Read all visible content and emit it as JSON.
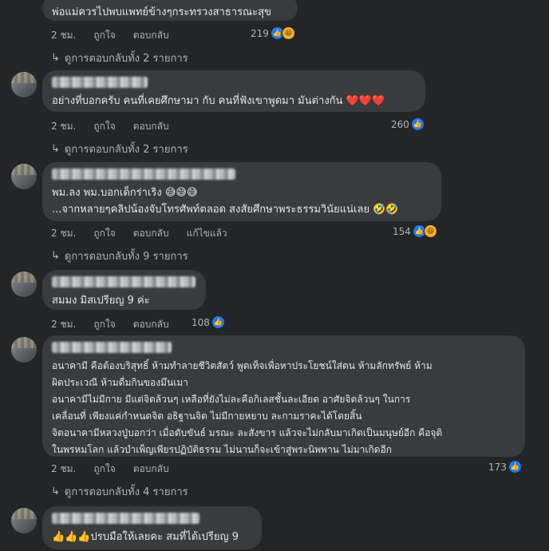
{
  "meta_labels": {
    "like": "ถูกใจ",
    "reply": "ตอบกลับ",
    "edited": "แก้ไขแล้ว"
  },
  "comments": [
    {
      "lines": [
        "พ่อแม่ควรไปพบแพทย์ข้างๆกระทรวงสาธารณะสุข"
      ],
      "time": "2 ชม.",
      "reaction_count": "219",
      "reactions": [
        "like-icon",
        "haha-icon"
      ],
      "replies": "ดูการตอบกลับทั้ง 2 รายการ"
    },
    {
      "lines": [
        "อย่างที่บอกครับ คนที่เคยศึกษามา กับ คนที่ฟังเขาพูดมา มันต่างกัน ❤️❤️❤️"
      ],
      "time": "2 ชม.",
      "reaction_count": "260",
      "reactions": [
        "like-icon"
      ],
      "replies": "ดูการตอบกลับทั้ง 2 รายการ"
    },
    {
      "lines": [
        "พม.ลง พม.บอกเด็กร่าเริง 😅😅😅",
        "...จากหลายๆคลิปน้องจับโทรศัพท์ตลอด สงสัยศึกษาพระธรรมวินัยแน่เลย 🤣🤣"
      ],
      "time": "2 ชม.",
      "reaction_count": "154",
      "reactions": [
        "like-icon",
        "haha-icon"
      ],
      "replies": "ดูการตอบกลับทั้ง 9 รายการ"
    },
    {
      "lines": [
        "สมมง มิสเปรียญ 9 ค่ะ"
      ],
      "time": "2 ชม.",
      "reaction_count": "108",
      "reactions": [
        "like-icon"
      ]
    },
    {
      "lines": [
        "อนาคามี คือต้องบริสุทธิ์ ห้ามทำลายชีวิตสัตว์ พูดเท็จเพื่อหาประโยชน์ใส่ตน ห้ามลักทรัพย์ ห้าม",
        "ผิดประเวณี ห้ามดื่มกินของมึนเมา",
        "อนาคามีไม่มีกาย มีแต่จิตล้วนๆ เหลือที่ยังไม่ละคือกิเลสชั้นละเอียด อาศัยจิตล้วนๆ ในการ",
        "เคลื่อนที่ เพียงแค่กำหนดจิต อธิฐานจิต ไม่มีกายหยาบ ละกามราคะได้โดยสิ้น",
        "จิตอนาคามีหลวงปู่บอกว่า เมื่อดับขันธ์ มรณะ ละสังขาร แล้วจะไม่กลับมาเกิดเป็นมนุษย์อีก คือจุติ",
        "ในพรหมโลก แล้วบำเพ็ญเพียรปฏิบัติธรรม ไม่นานก็จะเข้าสู่พระนิพพาน ไม่มาเกิดอีก"
      ],
      "time": "2 ชม.",
      "reaction_count": "173",
      "reactions": [
        "like-icon"
      ],
      "replies": "ดูการตอบกลับทั้ง 4 รายการ"
    },
    {
      "lines": [
        "👍👍👍ปรบมือให้เลยคะ สมที่ได้เปรียญ 9"
      ]
    }
  ],
  "colors": {
    "background": "#242526",
    "bubble": "#3a3b3c",
    "like": "#2078f4",
    "haha": "#f7b125",
    "meta": "#b0b3b8"
  }
}
